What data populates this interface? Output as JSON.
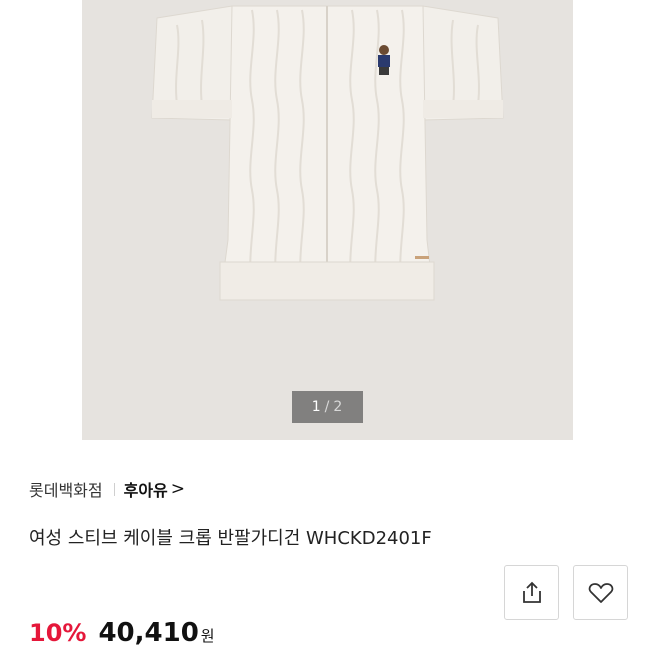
{
  "gallery": {
    "image_alt": "cream cable-knit short-sleeve cardigan with embroidered bear",
    "pager": {
      "current": "1",
      "separator": "/",
      "total": "2"
    }
  },
  "seller": {
    "store": "롯데백화점",
    "brand": "후아유",
    "chevron": ">"
  },
  "product": {
    "title": "여성 스티브 케이블 크롭 반팔가디건 WHCKD2401F"
  },
  "actions": {
    "share_icon": "share-icon",
    "like_icon": "heart-icon"
  },
  "price": {
    "discount": "10%",
    "amount": "40,410",
    "currency": "원"
  },
  "colors": {
    "discount": "#e5173a",
    "photo_bg": "#e6e3df",
    "knit": "#f4f1ec"
  }
}
